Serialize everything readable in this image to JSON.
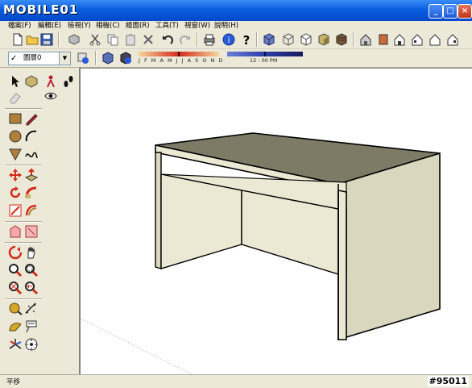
{
  "window": {
    "logo": "MOBILE01",
    "min_label": "_",
    "max_label": "□",
    "close_label": "×"
  },
  "menu": [
    "檔案(F)",
    "編輯(E)",
    "檢視(Y)",
    "相機(C)",
    "繪圖(R)",
    "工具(T)",
    "視窗(W)",
    "說明(H)"
  ],
  "layer": {
    "check": "✓",
    "name": "圖層0",
    "dropdown": "▼"
  },
  "shadow": {
    "months": "J F M A M J J A S O N D",
    "time": "12 : 00 PM"
  },
  "status": {
    "message": "平移",
    "watermark": "#95011"
  },
  "colors": {
    "title": "#0a5fe0",
    "face_top": "#7d7b66",
    "face_front": "#ebe9d3",
    "face_side": "#d9d7bd",
    "edge": "#000000",
    "accent_red": "#d42a1a"
  }
}
